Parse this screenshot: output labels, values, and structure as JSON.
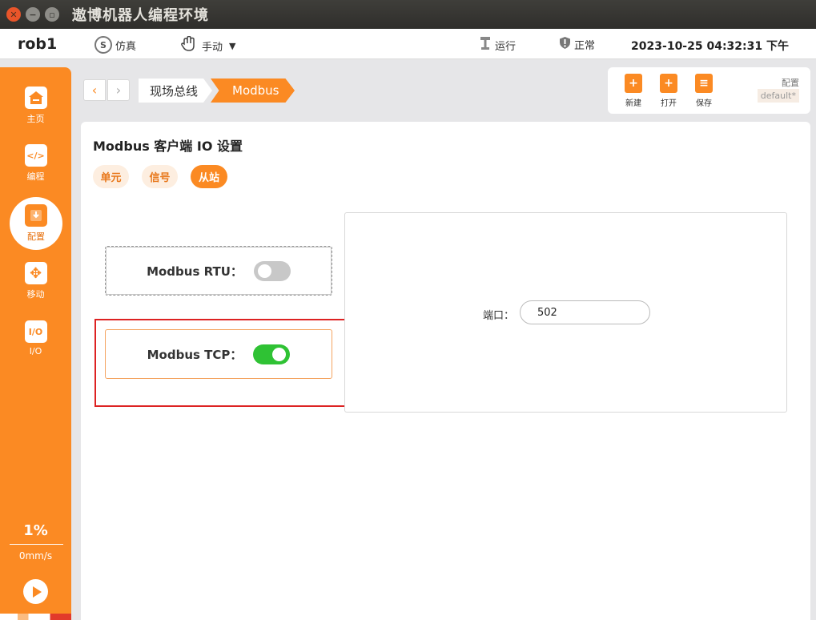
{
  "window": {
    "title": "遨博机器人编程环境"
  },
  "topbar": {
    "robot_name": "rob1",
    "sim_label": "仿真",
    "sim_icon_char": "S",
    "mode_label": "手动",
    "run_label": "运行",
    "status_label": "正常",
    "datetime": "2023-10-25 04:32:31 下午"
  },
  "sidebar": {
    "items": [
      {
        "label": "主页",
        "icon": "home-icon"
      },
      {
        "label": "编程",
        "icon": "code-icon",
        "glyph": "</>"
      },
      {
        "label": "配置",
        "icon": "config-icon"
      },
      {
        "label": "移动",
        "icon": "move-icon",
        "glyph": "✥"
      },
      {
        "label": "I/O",
        "icon": "io-icon",
        "glyph": "I/O"
      }
    ],
    "speed_percent": "1%",
    "speed_value": "0mm/s"
  },
  "breadcrumb": {
    "items": [
      "现场总线",
      "Modbus"
    ]
  },
  "file_toolbar": {
    "new_label": "新建",
    "open_label": "打开",
    "save_label": "保存",
    "config_label": "配置",
    "config_value": "default*"
  },
  "main": {
    "title": "Modbus 客户端 IO 设置",
    "tabs": [
      {
        "label": "单元",
        "active": false
      },
      {
        "label": "信号",
        "active": false
      },
      {
        "label": "从站",
        "active": true
      }
    ],
    "rtu": {
      "label": "Modbus RTU：",
      "enabled": false
    },
    "tcp": {
      "label": "Modbus TCP：",
      "enabled": true
    },
    "port": {
      "label": "端口：",
      "value": "502"
    }
  },
  "colors": {
    "accent": "#fb8a23",
    "toggle_on": "#2fc234",
    "highlight": "#dd2222"
  }
}
